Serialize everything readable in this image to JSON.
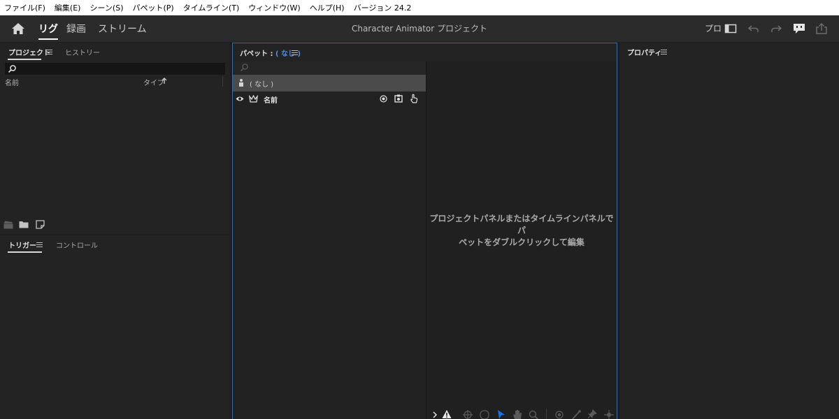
{
  "menubar": {
    "items": [
      "ファイル(F)",
      "編集(E)",
      "シーン(S)",
      "パペット(P)",
      "タイムライン(T)",
      "ウィンドウ(W)",
      "ヘルプ(H)",
      "バージョン 24.2"
    ]
  },
  "header": {
    "workspaces": [
      "リグ",
      "録画",
      "ストリーム"
    ],
    "active_workspace": "リグ",
    "title": "Character Animator プロジェクト",
    "right_label": "プロ"
  },
  "project_panel": {
    "tabs": [
      "プロジェクト",
      "ヒストリー"
    ],
    "search": {
      "value": "",
      "placeholder": ""
    },
    "columns": {
      "name": "名前",
      "type": "タイプ"
    }
  },
  "trigger_panel": {
    "tabs": [
      "トリガー",
      "コントロール"
    ]
  },
  "puppet_panel": {
    "title_prefix": "パペット : ",
    "title_value": "( なし )",
    "search": {
      "value": "",
      "placeholder": ""
    },
    "selected_puppet": "( なし )",
    "layer_header_name": "名前",
    "empty_message_line1": "プロジェクトパネルまたはタイムラインパネルでパ",
    "empty_message_line2": "ペットをダブルクリックして編集"
  },
  "properties_panel": {
    "title": "プロパティ"
  },
  "colors": {
    "accent": "#1473e6",
    "panel_bg": "#232323",
    "header_bg": "#2b2b2b",
    "menubar_bg": "#ffffff"
  }
}
